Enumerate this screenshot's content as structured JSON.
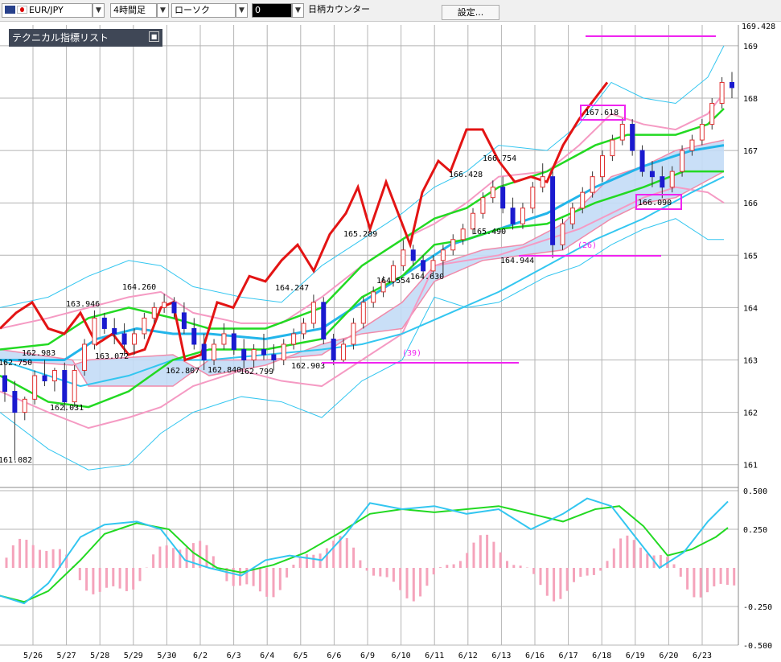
{
  "toolbar": {
    "pair": "EUR/JPY",
    "timeframe": "4時間足",
    "chart_style": "ローソク",
    "indicator_value": "0",
    "ticker_label": "日柄カウンター",
    "settings_label": "設定..."
  },
  "indicator_list": {
    "title": "テクニカル指標リスト"
  },
  "colors": {
    "bull": "#e03030",
    "bear": "#1a1acf",
    "ichimoku_red": "#e31414",
    "green": "#22d922",
    "cyan": "#33c6f0",
    "pink": "#f59ac3",
    "magenta": "#f024f0",
    "cloud": "#c3dcf6"
  },
  "chart_data": [
    {
      "type": "line",
      "subtype": "candlestick",
      "y_axis_label": "169.428",
      "ylim": [
        160.6,
        169.45
      ],
      "y_ticks": [
        161,
        162,
        163,
        164,
        165,
        166,
        167,
        168,
        169
      ],
      "x_ticks": [
        "5/26",
        "5/27",
        "5/28",
        "5/29",
        "5/30",
        "6/2",
        "6/3",
        "6/4",
        "6/5",
        "6/6",
        "6/9",
        "6/10",
        "6/11",
        "6/12",
        "6/13",
        "6/16",
        "6/17",
        "6/18",
        "6/19",
        "6/20",
        "6/23"
      ],
      "annotations": [
        "162.750",
        "163.946",
        "162.983",
        "163.072",
        "164.260",
        "162.807",
        "162.840",
        "162.799",
        "164.247",
        "162.903",
        "162.031",
        "161.082",
        "165.289",
        "164.554",
        "164.630",
        "166.428",
        "166.754",
        "165.490",
        "164.944",
        "167.618",
        "166.090",
        "(39)",
        "(26)"
      ],
      "candles_ohlc": [
        [
          162.7,
          162.95,
          162.2,
          162.4
        ],
        [
          162.4,
          162.6,
          161.08,
          162.0
        ],
        [
          162.0,
          162.3,
          161.85,
          162.25
        ],
        [
          162.25,
          162.8,
          162.15,
          162.7
        ],
        [
          162.7,
          163.0,
          162.5,
          162.6
        ],
        [
          162.6,
          162.85,
          162.4,
          162.8
        ],
        [
          162.8,
          162.95,
          162.031,
          162.2
        ],
        [
          162.2,
          162.9,
          162.1,
          162.8
        ],
        [
          162.8,
          163.4,
          162.7,
          163.3
        ],
        [
          163.3,
          163.946,
          163.2,
          163.8
        ],
        [
          163.8,
          163.9,
          163.5,
          163.6
        ],
        [
          163.6,
          163.8,
          163.3,
          163.5
        ],
        [
          163.5,
          163.7,
          163.072,
          163.3
        ],
        [
          163.3,
          163.6,
          163.1,
          163.5
        ],
        [
          163.5,
          163.9,
          163.4,
          163.8
        ],
        [
          163.8,
          164.1,
          163.7,
          164.0
        ],
        [
          164.0,
          164.26,
          163.9,
          164.1
        ],
        [
          164.1,
          164.2,
          163.8,
          163.9
        ],
        [
          163.9,
          164.1,
          163.5,
          163.6
        ],
        [
          163.6,
          163.8,
          163.2,
          163.3
        ],
        [
          163.3,
          163.5,
          162.807,
          163.0
        ],
        [
          163.0,
          163.4,
          162.9,
          163.3
        ],
        [
          163.3,
          163.7,
          163.2,
          163.5
        ],
        [
          163.5,
          163.6,
          163.1,
          163.2
        ],
        [
          163.2,
          163.4,
          162.84,
          163.0
        ],
        [
          163.0,
          163.3,
          162.85,
          163.2
        ],
        [
          163.2,
          163.5,
          163.0,
          163.1
        ],
        [
          163.1,
          163.3,
          162.799,
          163.0
        ],
        [
          163.0,
          163.4,
          162.9,
          163.3
        ],
        [
          163.3,
          163.6,
          163.2,
          163.5
        ],
        [
          163.5,
          163.8,
          163.4,
          163.7
        ],
        [
          163.7,
          164.247,
          163.6,
          164.1
        ],
        [
          164.1,
          164.2,
          163.3,
          163.4
        ],
        [
          163.4,
          163.5,
          162.903,
          163.0
        ],
        [
          163.0,
          163.4,
          162.95,
          163.3
        ],
        [
          163.3,
          163.8,
          163.2,
          163.7
        ],
        [
          163.7,
          164.2,
          163.6,
          164.1
        ],
        [
          164.1,
          164.4,
          164.0,
          164.3
        ],
        [
          164.3,
          164.6,
          164.2,
          164.5
        ],
        [
          164.5,
          164.9,
          164.4,
          164.8
        ],
        [
          164.8,
          165.289,
          164.7,
          165.1
        ],
        [
          165.1,
          165.2,
          164.8,
          164.9
        ],
        [
          164.9,
          165.0,
          164.554,
          164.7
        ],
        [
          164.7,
          165.0,
          164.6,
          164.9
        ],
        [
          164.9,
          165.2,
          164.63,
          165.1
        ],
        [
          165.1,
          165.4,
          165.0,
          165.3
        ],
        [
          165.3,
          165.6,
          165.2,
          165.5
        ],
        [
          165.5,
          165.9,
          165.4,
          165.8
        ],
        [
          165.8,
          166.2,
          165.7,
          166.1
        ],
        [
          166.1,
          166.428,
          166.0,
          166.3
        ],
        [
          166.3,
          166.5,
          165.8,
          165.9
        ],
        [
          165.9,
          166.1,
          165.49,
          165.6
        ],
        [
          165.6,
          166.0,
          165.5,
          165.9
        ],
        [
          165.9,
          166.4,
          165.8,
          166.3
        ],
        [
          166.3,
          166.754,
          166.2,
          166.5
        ],
        [
          166.5,
          166.6,
          164.944,
          165.2
        ],
        [
          165.2,
          165.7,
          165.1,
          165.6
        ],
        [
          165.6,
          166.0,
          165.5,
          165.9
        ],
        [
          165.9,
          166.3,
          165.8,
          166.2
        ],
        [
          166.2,
          166.6,
          166.1,
          166.5
        ],
        [
          166.5,
          167.0,
          166.4,
          166.9
        ],
        [
          166.9,
          167.3,
          166.8,
          167.2
        ],
        [
          167.2,
          167.618,
          167.1,
          167.5
        ],
        [
          167.5,
          167.6,
          166.9,
          167.0
        ],
        [
          167.0,
          167.1,
          166.5,
          166.6
        ],
        [
          166.6,
          166.8,
          166.3,
          166.5
        ],
        [
          166.5,
          166.7,
          166.09,
          166.3
        ],
        [
          166.3,
          166.7,
          166.2,
          166.6
        ],
        [
          166.6,
          167.1,
          166.5,
          167.0
        ],
        [
          167.0,
          167.3,
          166.9,
          167.2
        ],
        [
          167.2,
          167.6,
          167.1,
          167.5
        ],
        [
          167.5,
          168.0,
          167.4,
          167.9
        ],
        [
          167.9,
          168.4,
          167.8,
          168.3
        ],
        [
          168.3,
          168.5,
          168.0,
          168.2
        ]
      ]
    },
    {
      "type": "line",
      "subtype": "oscillator",
      "ylim": [
        -0.5,
        0.55
      ],
      "y_ticks": [
        0.5,
        0.25,
        -0.25,
        -0.5
      ],
      "y_tick_labels": [
        "0.500",
        "0.250",
        "-0.250",
        "-0.500"
      ]
    }
  ]
}
